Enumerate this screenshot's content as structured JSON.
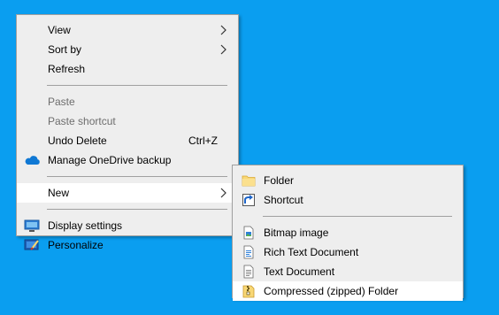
{
  "desktop": {
    "background_color": "#0a9ef0"
  },
  "context_menu": {
    "view_label": "View",
    "sort_by_label": "Sort by",
    "refresh_label": "Refresh",
    "paste_label": "Paste",
    "paste_shortcut_label": "Paste shortcut",
    "undo_delete_label": "Undo Delete",
    "undo_delete_shortcut": "Ctrl+Z",
    "onedrive_label": "Manage OneDrive backup",
    "new_label": "New",
    "display_settings_label": "Display settings",
    "personalize_label": "Personalize",
    "icons": {
      "onedrive": "onedrive-cloud-icon",
      "display": "display-monitor-icon",
      "personalize": "personalize-icon",
      "submenu": "chevron-right-icon"
    }
  },
  "new_submenu": {
    "folder_label": "Folder",
    "shortcut_label": "Shortcut",
    "bitmap_label": "Bitmap image",
    "rtf_label": "Rich Text Document",
    "text_label": "Text Document",
    "zip_label": "Compressed (zipped) Folder",
    "icons": {
      "folder": "folder-icon",
      "shortcut": "shortcut-arrow-icon",
      "bitmap": "bitmap-image-icon",
      "rtf": "rich-text-document-icon",
      "text": "text-document-icon",
      "zip": "zipped-folder-icon"
    }
  }
}
